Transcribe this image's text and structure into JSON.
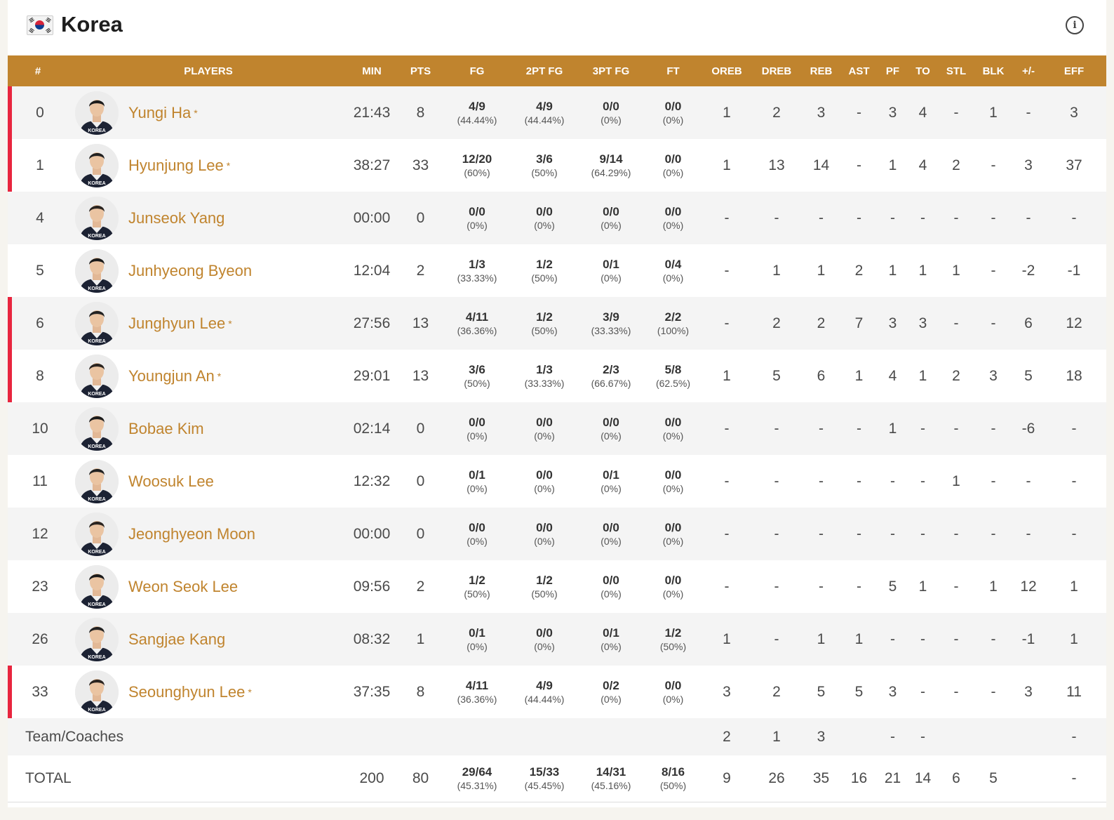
{
  "team": {
    "name": "Korea"
  },
  "columns": [
    "#",
    "PLAYERS",
    "MIN",
    "PTS",
    "FG",
    "2PT FG",
    "3PT FG",
    "FT",
    "OREB",
    "DREB",
    "REB",
    "AST",
    "PF",
    "TO",
    "STL",
    "BLK",
    "+/-",
    "EFF"
  ],
  "players": [
    {
      "num": "0",
      "name": "Yungi Ha",
      "starter": true,
      "min": "21:43",
      "pts": "8",
      "fg": "4/9",
      "fg_pct": "(44.44%)",
      "fg2": "4/9",
      "fg2_pct": "(44.44%)",
      "fg3": "0/0",
      "fg3_pct": "(0%)",
      "ft": "0/0",
      "ft_pct": "(0%)",
      "oreb": "1",
      "dreb": "2",
      "reb": "3",
      "ast": "-",
      "pf": "3",
      "to": "4",
      "stl": "-",
      "blk": "1",
      "pm": "-",
      "eff": "3"
    },
    {
      "num": "1",
      "name": "Hyunjung Lee",
      "starter": true,
      "min": "38:27",
      "pts": "33",
      "fg": "12/20",
      "fg_pct": "(60%)",
      "fg2": "3/6",
      "fg2_pct": "(50%)",
      "fg3": "9/14",
      "fg3_pct": "(64.29%)",
      "ft": "0/0",
      "ft_pct": "(0%)",
      "oreb": "1",
      "dreb": "13",
      "reb": "14",
      "ast": "-",
      "pf": "1",
      "to": "4",
      "stl": "2",
      "blk": "-",
      "pm": "3",
      "eff": "37"
    },
    {
      "num": "4",
      "name": "Junseok Yang",
      "starter": false,
      "min": "00:00",
      "pts": "0",
      "fg": "0/0",
      "fg_pct": "(0%)",
      "fg2": "0/0",
      "fg2_pct": "(0%)",
      "fg3": "0/0",
      "fg3_pct": "(0%)",
      "ft": "0/0",
      "ft_pct": "(0%)",
      "oreb": "-",
      "dreb": "-",
      "reb": "-",
      "ast": "-",
      "pf": "-",
      "to": "-",
      "stl": "-",
      "blk": "-",
      "pm": "-",
      "eff": "-"
    },
    {
      "num": "5",
      "name": "Junhyeong Byeon",
      "starter": false,
      "min": "12:04",
      "pts": "2",
      "fg": "1/3",
      "fg_pct": "(33.33%)",
      "fg2": "1/2",
      "fg2_pct": "(50%)",
      "fg3": "0/1",
      "fg3_pct": "(0%)",
      "ft": "0/4",
      "ft_pct": "(0%)",
      "oreb": "-",
      "dreb": "1",
      "reb": "1",
      "ast": "2",
      "pf": "1",
      "to": "1",
      "stl": "1",
      "blk": "-",
      "pm": "-2",
      "eff": "-1"
    },
    {
      "num": "6",
      "name": "Junghyun Lee",
      "starter": true,
      "min": "27:56",
      "pts": "13",
      "fg": "4/11",
      "fg_pct": "(36.36%)",
      "fg2": "1/2",
      "fg2_pct": "(50%)",
      "fg3": "3/9",
      "fg3_pct": "(33.33%)",
      "ft": "2/2",
      "ft_pct": "(100%)",
      "oreb": "-",
      "dreb": "2",
      "reb": "2",
      "ast": "7",
      "pf": "3",
      "to": "3",
      "stl": "-",
      "blk": "-",
      "pm": "6",
      "eff": "12"
    },
    {
      "num": "8",
      "name": "Youngjun An",
      "starter": true,
      "min": "29:01",
      "pts": "13",
      "fg": "3/6",
      "fg_pct": "(50%)",
      "fg2": "1/3",
      "fg2_pct": "(33.33%)",
      "fg3": "2/3",
      "fg3_pct": "(66.67%)",
      "ft": "5/8",
      "ft_pct": "(62.5%)",
      "oreb": "1",
      "dreb": "5",
      "reb": "6",
      "ast": "1",
      "pf": "4",
      "to": "1",
      "stl": "2",
      "blk": "3",
      "pm": "5",
      "eff": "18"
    },
    {
      "num": "10",
      "name": "Bobae Kim",
      "starter": false,
      "min": "02:14",
      "pts": "0",
      "fg": "0/0",
      "fg_pct": "(0%)",
      "fg2": "0/0",
      "fg2_pct": "(0%)",
      "fg3": "0/0",
      "fg3_pct": "(0%)",
      "ft": "0/0",
      "ft_pct": "(0%)",
      "oreb": "-",
      "dreb": "-",
      "reb": "-",
      "ast": "-",
      "pf": "1",
      "to": "-",
      "stl": "-",
      "blk": "-",
      "pm": "-6",
      "eff": "-"
    },
    {
      "num": "11",
      "name": "Woosuk Lee",
      "starter": false,
      "min": "12:32",
      "pts": "0",
      "fg": "0/1",
      "fg_pct": "(0%)",
      "fg2": "0/0",
      "fg2_pct": "(0%)",
      "fg3": "0/1",
      "fg3_pct": "(0%)",
      "ft": "0/0",
      "ft_pct": "(0%)",
      "oreb": "-",
      "dreb": "-",
      "reb": "-",
      "ast": "-",
      "pf": "-",
      "to": "-",
      "stl": "1",
      "blk": "-",
      "pm": "-",
      "eff": "-"
    },
    {
      "num": "12",
      "name": "Jeonghyeon Moon",
      "starter": false,
      "min": "00:00",
      "pts": "0",
      "fg": "0/0",
      "fg_pct": "(0%)",
      "fg2": "0/0",
      "fg2_pct": "(0%)",
      "fg3": "0/0",
      "fg3_pct": "(0%)",
      "ft": "0/0",
      "ft_pct": "(0%)",
      "oreb": "-",
      "dreb": "-",
      "reb": "-",
      "ast": "-",
      "pf": "-",
      "to": "-",
      "stl": "-",
      "blk": "-",
      "pm": "-",
      "eff": "-"
    },
    {
      "num": "23",
      "name": "Weon Seok Lee",
      "starter": false,
      "min": "09:56",
      "pts": "2",
      "fg": "1/2",
      "fg_pct": "(50%)",
      "fg2": "1/2",
      "fg2_pct": "(50%)",
      "fg3": "0/0",
      "fg3_pct": "(0%)",
      "ft": "0/0",
      "ft_pct": "(0%)",
      "oreb": "-",
      "dreb": "-",
      "reb": "-",
      "ast": "-",
      "pf": "5",
      "to": "1",
      "stl": "-",
      "blk": "1",
      "pm": "12",
      "eff": "1"
    },
    {
      "num": "26",
      "name": "Sangjae Kang",
      "starter": false,
      "min": "08:32",
      "pts": "1",
      "fg": "0/1",
      "fg_pct": "(0%)",
      "fg2": "0/0",
      "fg2_pct": "(0%)",
      "fg3": "0/1",
      "fg3_pct": "(0%)",
      "ft": "1/2",
      "ft_pct": "(50%)",
      "oreb": "1",
      "dreb": "-",
      "reb": "1",
      "ast": "1",
      "pf": "-",
      "to": "-",
      "stl": "-",
      "blk": "-",
      "pm": "-1",
      "eff": "1"
    },
    {
      "num": "33",
      "name": "Seounghyun Lee",
      "starter": true,
      "min": "37:35",
      "pts": "8",
      "fg": "4/11",
      "fg_pct": "(36.36%)",
      "fg2": "4/9",
      "fg2_pct": "(44.44%)",
      "fg3": "0/2",
      "fg3_pct": "(0%)",
      "ft": "0/0",
      "ft_pct": "(0%)",
      "oreb": "3",
      "dreb": "2",
      "reb": "5",
      "ast": "5",
      "pf": "3",
      "to": "-",
      "stl": "-",
      "blk": "-",
      "pm": "3",
      "eff": "11"
    }
  ],
  "team_row": {
    "label": "Team/Coaches",
    "oreb": "2",
    "dreb": "1",
    "reb": "3",
    "pf": "-",
    "to": "-",
    "eff": "-"
  },
  "total_row": {
    "label": "TOTAL",
    "min": "200",
    "pts": "80",
    "fg": "29/64",
    "fg_pct": "(45.31%)",
    "fg2": "15/33",
    "fg2_pct": "(45.45%)",
    "fg3": "14/31",
    "fg3_pct": "(45.16%)",
    "ft": "8/16",
    "ft_pct": "(50%)",
    "oreb": "9",
    "dreb": "26",
    "reb": "35",
    "ast": "16",
    "pf": "21",
    "to": "14",
    "stl": "6",
    "blk": "5",
    "pm": "",
    "eff": "-"
  },
  "starter_mark": "*",
  "icons": {
    "flag": "korea-flag-icon",
    "info": "info-icon"
  },
  "colors": {
    "accent": "#c0842e",
    "starter_bar": "#e8253e"
  }
}
